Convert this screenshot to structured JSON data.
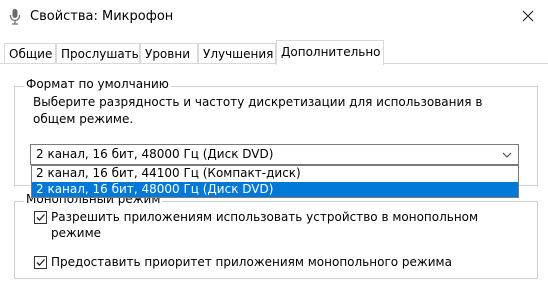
{
  "window": {
    "title": "Свойства: Микрофон"
  },
  "tabs": [
    {
      "label": "Общие"
    },
    {
      "label": "Прослушать"
    },
    {
      "label": "Уровни"
    },
    {
      "label": "Улучшения"
    },
    {
      "label": "Дополнительно",
      "active": true
    }
  ],
  "default_format": {
    "legend": "Формат по умолчанию",
    "description": "Выберите разрядность и частоту дискретизации для использования в общем режиме.",
    "selected_value": "2 канал, 16 бит, 48000 Гц (Диск DVD)",
    "options": [
      "2 канал, 16 бит, 44100 Гц (Компакт-диск)",
      "2 канал, 16 бит, 48000 Гц (Диск DVD)"
    ],
    "highlighted_option_index": 1
  },
  "exclusive_mode": {
    "legend": "Монопольный режим",
    "allow_exclusive": {
      "label": "Разрешить приложениям использовать устройство в монопольном режиме",
      "checked": true
    },
    "give_priority": {
      "label": "Предоставить приоритет приложениям монопольного режима",
      "checked": true
    }
  },
  "colors": {
    "selection": "#0078d7",
    "border": "#7a7a7a"
  },
  "icons": {
    "title": "microphone-icon",
    "close": "close-icon",
    "dropdown": "chevron-down-icon",
    "check": "checkmark-icon"
  }
}
